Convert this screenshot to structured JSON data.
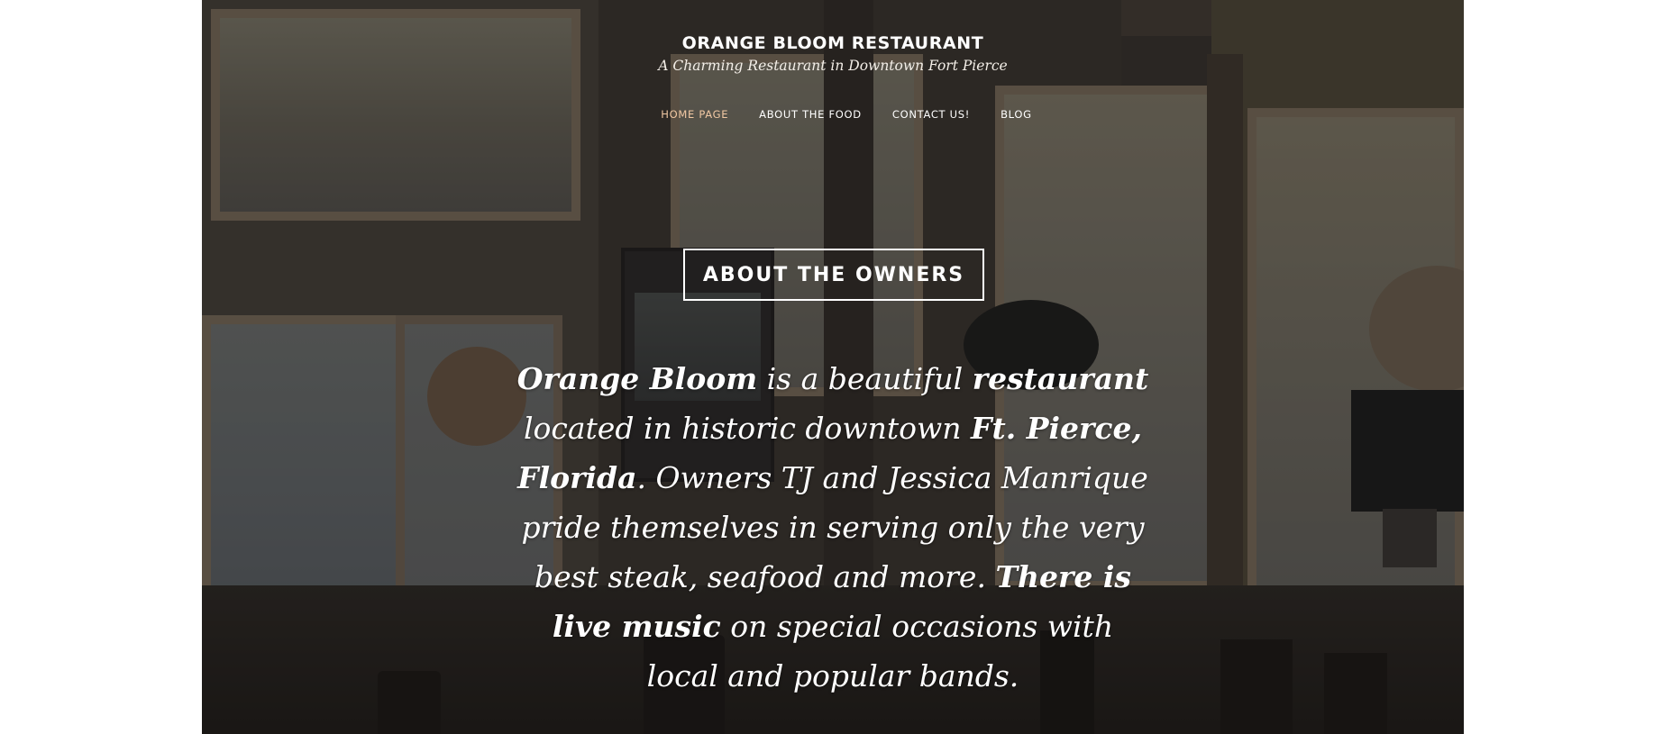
{
  "site": {
    "title": "ORANGE BLOOM RESTAURANT",
    "tagline": "A Charming Restaurant in Downtown Fort Pierce"
  },
  "nav": {
    "items": [
      {
        "label": "HOME PAGE",
        "current": true
      },
      {
        "label": "ABOUT THE FOOD",
        "current": false
      },
      {
        "label": "CONTACT US!",
        "current": false
      },
      {
        "label": "BLOG",
        "current": false
      }
    ]
  },
  "section": {
    "heading": "ABOUT THE OWNERS"
  },
  "intro": {
    "segments": [
      {
        "text": "Orange Bloom",
        "bold": true
      },
      {
        "text": " is a beautiful ",
        "bold": false
      },
      {
        "text": "restaurant",
        "bold": true
      },
      {
        "text": " located in historic downtown ",
        "bold": false
      },
      {
        "text": "Ft. Pierce, Florida",
        "bold": true
      },
      {
        "text": ". Owners TJ and Jessica Manrique pride themselves in serving only the very best steak, seafood and more. ",
        "bold": false
      },
      {
        "text": "There is live music",
        "bold": true
      },
      {
        "text": " on special occasions with local and popular bands.",
        "bold": false
      }
    ]
  },
  "theme": {
    "page_background": "#ffffff",
    "text": "#ffffff",
    "nav_current": "#f1c8a3",
    "overlay": "rgba(20, 16, 14, 0.42)"
  },
  "images": {
    "hero": "restaurant-interior-photo"
  }
}
